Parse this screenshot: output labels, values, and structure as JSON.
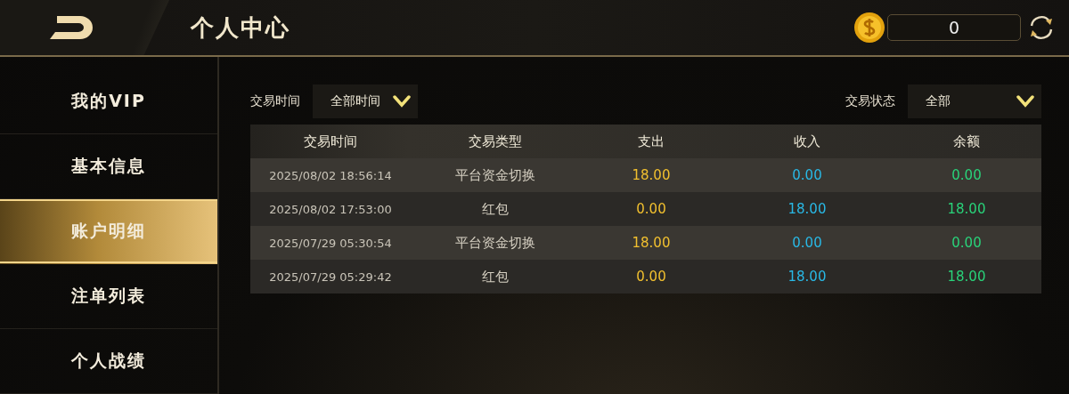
{
  "header": {
    "title": "个人中心",
    "balance": "0"
  },
  "sidebar": {
    "items": [
      {
        "label": "我的VIP",
        "selected": false
      },
      {
        "label": "基本信息",
        "selected": false
      },
      {
        "label": "账户明细",
        "selected": true
      },
      {
        "label": "注单列表",
        "selected": false
      },
      {
        "label": "个人战绩",
        "selected": false
      }
    ]
  },
  "filters": {
    "time_label": "交易时间",
    "time_value": "全部时间",
    "status_label": "交易状态",
    "status_value": "全部"
  },
  "table": {
    "columns": [
      "交易时间",
      "交易类型",
      "支出",
      "收入",
      "余额"
    ],
    "rows": [
      [
        "2025/08/02 18:56:14",
        "平台资金切换",
        "18.00",
        "0.00",
        "0.00"
      ],
      [
        "2025/08/02 17:53:00",
        "红包",
        "0.00",
        "18.00",
        "18.00"
      ],
      [
        "2025/07/29 05:30:54",
        "平台资金切换",
        "18.00",
        "0.00",
        "0.00"
      ],
      [
        "2025/07/29 05:29:42",
        "红包",
        "0.00",
        "18.00",
        "18.00"
      ]
    ]
  }
}
